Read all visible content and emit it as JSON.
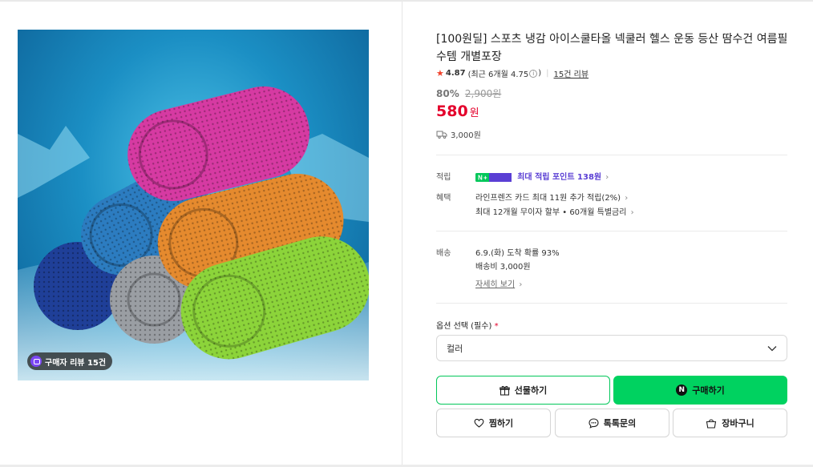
{
  "product": {
    "title": "[100원딜] 스포츠 냉감 아이스쿨타올 넥쿨러 헬스 운동 등산 땀수건 여름필수템 개별포장",
    "image_review_badge": "구매자 리뷰 15건"
  },
  "rating": {
    "score": "4.87",
    "recent_prefix": "(최근 6개월 4.75",
    "recent_suffix": ")",
    "review_count": "15건 리뷰"
  },
  "price": {
    "discount_rate": "80%",
    "original": "2,900원",
    "sale": "580",
    "sale_unit": "원",
    "shipping": "3,000원"
  },
  "benefits": {
    "points_label": "적립",
    "points_badge": "N+멤버십",
    "points_text": "최대 적립 포인트 138원",
    "benefit_label": "혜택",
    "benefit_line1": "라인프렌즈 카드 최대 11원 추가 적립(2%)",
    "benefit_line2": "최대 12개월 무이자 할부 • 60개월 특별금리"
  },
  "delivery": {
    "label": "배송",
    "line1": "6.9.(화) 도착 확률 93%",
    "line2": "배송비 3,000원",
    "detail_link": "자세히 보기"
  },
  "option": {
    "label": "옵션 선택 (필수)",
    "required_mark": "*",
    "selected": "컬러"
  },
  "buttons": {
    "gift": "선물하기",
    "buy": "구매하기",
    "buy_badge": "N",
    "wish": "찜하기",
    "talk": "톡톡문의",
    "cart": "장바구니"
  },
  "colors": {
    "accent_green": "#00d260",
    "price_red": "#e4002b",
    "point_purple": "#5a3fd4",
    "star": "#f0422b"
  },
  "icons": [
    "star-icon",
    "info-icon",
    "delivery-truck-icon",
    "chevron-right-icon",
    "chevron-down-icon",
    "gift-icon",
    "heart-icon",
    "chat-bubble-icon",
    "shopping-bag-icon",
    "review-photo-icon"
  ]
}
